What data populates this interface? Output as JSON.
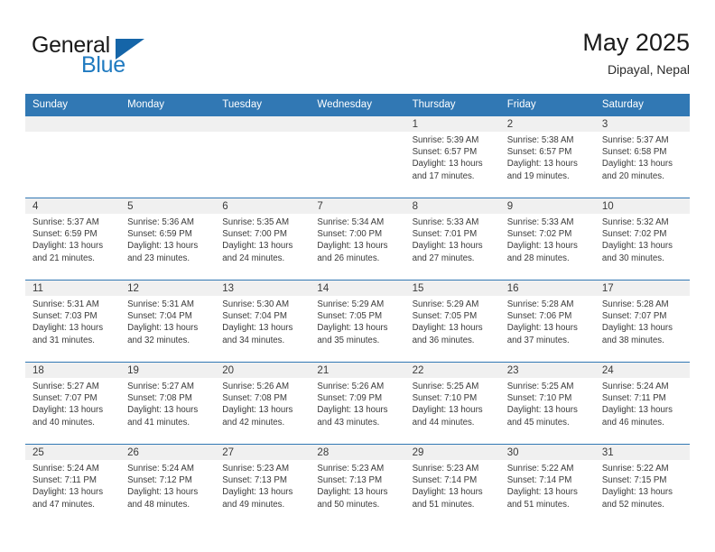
{
  "brand": {
    "word_one": "General",
    "word_two": "Blue",
    "flag_icon": "blue-triangle-flag-icon"
  },
  "header": {
    "title": "May 2025",
    "location": "Dipayal, Nepal"
  },
  "theme": {
    "header_blue": "#3178b4",
    "brand_blue": "#1f7ac0",
    "daynum_band": "#f0f0f0",
    "text": "#3a3a3a"
  },
  "calendar": {
    "weekday_headers": [
      "Sunday",
      "Monday",
      "Tuesday",
      "Wednesday",
      "Thursday",
      "Friday",
      "Saturday"
    ],
    "weeks": [
      [
        {
          "day": "",
          "lines": []
        },
        {
          "day": "",
          "lines": []
        },
        {
          "day": "",
          "lines": []
        },
        {
          "day": "",
          "lines": []
        },
        {
          "day": "1",
          "lines": [
            "Sunrise: 5:39 AM",
            "Sunset: 6:57 PM",
            "Daylight: 13 hours",
            "and 17 minutes."
          ]
        },
        {
          "day": "2",
          "lines": [
            "Sunrise: 5:38 AM",
            "Sunset: 6:57 PM",
            "Daylight: 13 hours",
            "and 19 minutes."
          ]
        },
        {
          "day": "3",
          "lines": [
            "Sunrise: 5:37 AM",
            "Sunset: 6:58 PM",
            "Daylight: 13 hours",
            "and 20 minutes."
          ]
        }
      ],
      [
        {
          "day": "4",
          "lines": [
            "Sunrise: 5:37 AM",
            "Sunset: 6:59 PM",
            "Daylight: 13 hours",
            "and 21 minutes."
          ]
        },
        {
          "day": "5",
          "lines": [
            "Sunrise: 5:36 AM",
            "Sunset: 6:59 PM",
            "Daylight: 13 hours",
            "and 23 minutes."
          ]
        },
        {
          "day": "6",
          "lines": [
            "Sunrise: 5:35 AM",
            "Sunset: 7:00 PM",
            "Daylight: 13 hours",
            "and 24 minutes."
          ]
        },
        {
          "day": "7",
          "lines": [
            "Sunrise: 5:34 AM",
            "Sunset: 7:00 PM",
            "Daylight: 13 hours",
            "and 26 minutes."
          ]
        },
        {
          "day": "8",
          "lines": [
            "Sunrise: 5:33 AM",
            "Sunset: 7:01 PM",
            "Daylight: 13 hours",
            "and 27 minutes."
          ]
        },
        {
          "day": "9",
          "lines": [
            "Sunrise: 5:33 AM",
            "Sunset: 7:02 PM",
            "Daylight: 13 hours",
            "and 28 minutes."
          ]
        },
        {
          "day": "10",
          "lines": [
            "Sunrise: 5:32 AM",
            "Sunset: 7:02 PM",
            "Daylight: 13 hours",
            "and 30 minutes."
          ]
        }
      ],
      [
        {
          "day": "11",
          "lines": [
            "Sunrise: 5:31 AM",
            "Sunset: 7:03 PM",
            "Daylight: 13 hours",
            "and 31 minutes."
          ]
        },
        {
          "day": "12",
          "lines": [
            "Sunrise: 5:31 AM",
            "Sunset: 7:04 PM",
            "Daylight: 13 hours",
            "and 32 minutes."
          ]
        },
        {
          "day": "13",
          "lines": [
            "Sunrise: 5:30 AM",
            "Sunset: 7:04 PM",
            "Daylight: 13 hours",
            "and 34 minutes."
          ]
        },
        {
          "day": "14",
          "lines": [
            "Sunrise: 5:29 AM",
            "Sunset: 7:05 PM",
            "Daylight: 13 hours",
            "and 35 minutes."
          ]
        },
        {
          "day": "15",
          "lines": [
            "Sunrise: 5:29 AM",
            "Sunset: 7:05 PM",
            "Daylight: 13 hours",
            "and 36 minutes."
          ]
        },
        {
          "day": "16",
          "lines": [
            "Sunrise: 5:28 AM",
            "Sunset: 7:06 PM",
            "Daylight: 13 hours",
            "and 37 minutes."
          ]
        },
        {
          "day": "17",
          "lines": [
            "Sunrise: 5:28 AM",
            "Sunset: 7:07 PM",
            "Daylight: 13 hours",
            "and 38 minutes."
          ]
        }
      ],
      [
        {
          "day": "18",
          "lines": [
            "Sunrise: 5:27 AM",
            "Sunset: 7:07 PM",
            "Daylight: 13 hours",
            "and 40 minutes."
          ]
        },
        {
          "day": "19",
          "lines": [
            "Sunrise: 5:27 AM",
            "Sunset: 7:08 PM",
            "Daylight: 13 hours",
            "and 41 minutes."
          ]
        },
        {
          "day": "20",
          "lines": [
            "Sunrise: 5:26 AM",
            "Sunset: 7:08 PM",
            "Daylight: 13 hours",
            "and 42 minutes."
          ]
        },
        {
          "day": "21",
          "lines": [
            "Sunrise: 5:26 AM",
            "Sunset: 7:09 PM",
            "Daylight: 13 hours",
            "and 43 minutes."
          ]
        },
        {
          "day": "22",
          "lines": [
            "Sunrise: 5:25 AM",
            "Sunset: 7:10 PM",
            "Daylight: 13 hours",
            "and 44 minutes."
          ]
        },
        {
          "day": "23",
          "lines": [
            "Sunrise: 5:25 AM",
            "Sunset: 7:10 PM",
            "Daylight: 13 hours",
            "and 45 minutes."
          ]
        },
        {
          "day": "24",
          "lines": [
            "Sunrise: 5:24 AM",
            "Sunset: 7:11 PM",
            "Daylight: 13 hours",
            "and 46 minutes."
          ]
        }
      ],
      [
        {
          "day": "25",
          "lines": [
            "Sunrise: 5:24 AM",
            "Sunset: 7:11 PM",
            "Daylight: 13 hours",
            "and 47 minutes."
          ]
        },
        {
          "day": "26",
          "lines": [
            "Sunrise: 5:24 AM",
            "Sunset: 7:12 PM",
            "Daylight: 13 hours",
            "and 48 minutes."
          ]
        },
        {
          "day": "27",
          "lines": [
            "Sunrise: 5:23 AM",
            "Sunset: 7:13 PM",
            "Daylight: 13 hours",
            "and 49 minutes."
          ]
        },
        {
          "day": "28",
          "lines": [
            "Sunrise: 5:23 AM",
            "Sunset: 7:13 PM",
            "Daylight: 13 hours",
            "and 50 minutes."
          ]
        },
        {
          "day": "29",
          "lines": [
            "Sunrise: 5:23 AM",
            "Sunset: 7:14 PM",
            "Daylight: 13 hours",
            "and 51 minutes."
          ]
        },
        {
          "day": "30",
          "lines": [
            "Sunrise: 5:22 AM",
            "Sunset: 7:14 PM",
            "Daylight: 13 hours",
            "and 51 minutes."
          ]
        },
        {
          "day": "31",
          "lines": [
            "Sunrise: 5:22 AM",
            "Sunset: 7:15 PM",
            "Daylight: 13 hours",
            "and 52 minutes."
          ]
        }
      ]
    ]
  }
}
